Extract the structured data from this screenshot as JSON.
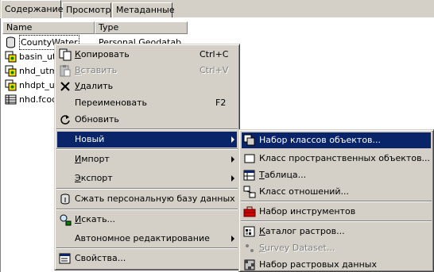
{
  "tabs": [
    {
      "label": "Содержание",
      "active": true
    },
    {
      "label": "Просмотр",
      "active": false
    },
    {
      "label": "Метаданные",
      "active": false
    }
  ],
  "columns": {
    "name": "Name",
    "type": "Type"
  },
  "items": [
    {
      "name": "CountyWater",
      "type": "Personal Geodatab",
      "icon": "geodatabase-icon"
    },
    {
      "name": "basin_utm",
      "type": "",
      "icon": "feature-dataset-icon"
    },
    {
      "name": "nhd_utm",
      "type": "",
      "icon": "feature-dataset-icon"
    },
    {
      "name": "nhdpt_utm",
      "type": "",
      "icon": "feature-dataset-icon"
    },
    {
      "name": "nhd.fcode",
      "type": "",
      "icon": "table-icon"
    }
  ],
  "context_menu": [
    {
      "label": "Копировать",
      "mnemonic": "К",
      "rest": "опировать",
      "shortcut": "Ctrl+C",
      "icon": "copy-icon",
      "disabled": false
    },
    {
      "label": "Вставить",
      "mnemonic": "В",
      "rest": "ставить",
      "shortcut": "Ctrl+V",
      "icon": "paste-icon",
      "disabled": true
    },
    {
      "label": "Удалить",
      "mnemonic": "У",
      "rest": "далить",
      "shortcut": "",
      "icon": "delete-icon",
      "disabled": false
    },
    {
      "label": "Переименовать",
      "shortcut": "F2",
      "disabled": false
    },
    {
      "label": "Обновить",
      "shortcut": "",
      "icon": "refresh-icon",
      "disabled": false
    },
    {
      "label": "Новый",
      "submenu": true,
      "highlighted": true
    },
    {
      "label": "Импорт",
      "mnemonic": "И",
      "rest": "мпорт",
      "submenu": true
    },
    {
      "label": "Экспорт",
      "mnemonic": "Э",
      "rest": "кспорт",
      "submenu": true
    },
    {
      "label": "Сжать персональную базу данных",
      "icon": "compact-database-icon"
    },
    {
      "label": "Искать...",
      "mnemonic": "И",
      "rest": "скать...",
      "icon": "search-icon"
    },
    {
      "label": "Автономное редактирование",
      "submenu": true
    },
    {
      "label": "Свойства...",
      "icon": "properties-icon"
    }
  ],
  "submenu_new": [
    {
      "label": "Набор классов объектов...",
      "icon": "feature-dataset-icon",
      "highlighted": true
    },
    {
      "label": "Класс пространственных объектов...",
      "icon": "feature-class-icon"
    },
    {
      "label": "Таблица...",
      "mnemonic": "Т",
      "rest": "аблица...",
      "icon": "table-icon"
    },
    {
      "label": "Класс отношений...",
      "icon": "relationship-class-icon"
    },
    {
      "label": "Набор инструментов",
      "icon": "toolbox-icon"
    },
    {
      "label": "Каталог растров...",
      "mnemonic": "К",
      "rest": "аталог растров...",
      "icon": "raster-catalog-icon"
    },
    {
      "label": "Survey Dataset...",
      "mnemonic": "S",
      "rest": "urvey Dataset...",
      "icon": "survey-dataset-icon",
      "disabled": true
    },
    {
      "label": "Набор растровых данных",
      "icon": "raster-dataset-icon"
    }
  ],
  "colors": {
    "highlight": "#0a246a",
    "face": "#d4d0c8",
    "disabled": "#808080"
  }
}
